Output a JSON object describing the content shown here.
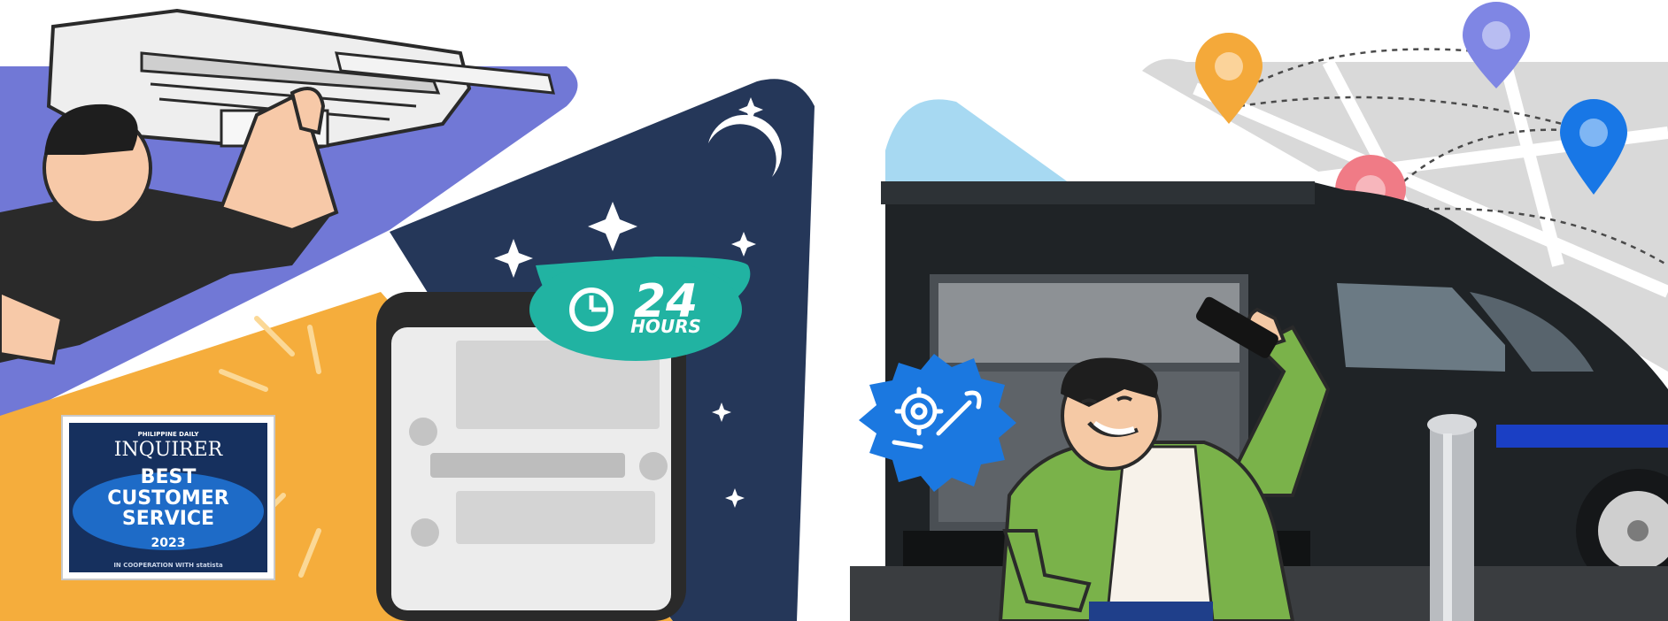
{
  "illustration": {
    "badge": {
      "publisher_line": "PHILIPPINE DAILY",
      "publisher": "INQUIRER",
      "award_line1": "BEST",
      "award_line2": "CUSTOMER",
      "award_line3": "SERVICE",
      "year": "2023",
      "footer": "IN COOPERATION WITH statista"
    },
    "bubble": {
      "number": "24",
      "unit": "HOURS"
    }
  },
  "colors": {
    "purple_band": "#7178d6",
    "orange_panel": "#f5ad3c",
    "night_navy": "#253759",
    "van_black": "#1f2326",
    "bubble_teal": "#21b3a2",
    "gear_blue": "#1b78e0",
    "jacket_green": "#7ab24a",
    "pin_orange": "#f4a93a",
    "pin_purple": "#7f86e4",
    "pin_blue": "#1877e6",
    "pin_pink": "#f07b86",
    "badge_navy": "#16305e"
  }
}
